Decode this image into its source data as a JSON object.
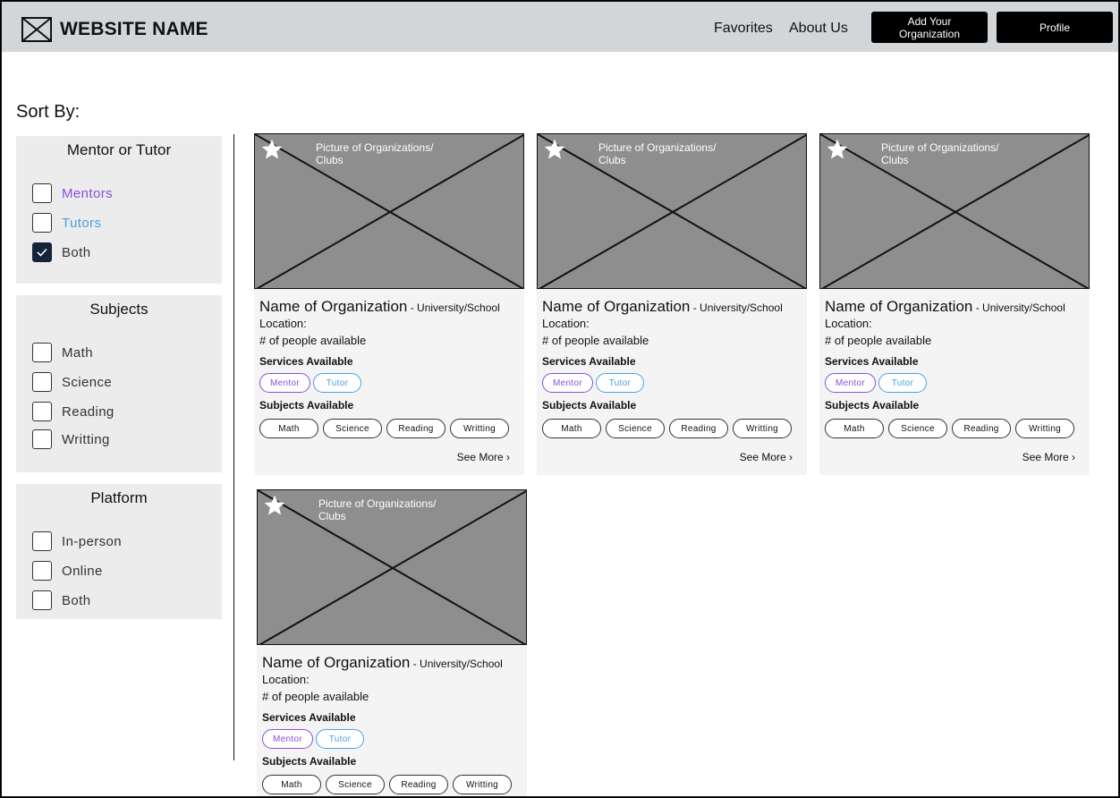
{
  "header": {
    "site_name": "WEBSITE NAME",
    "nav": {
      "favorites": "Favorites",
      "about": "About Us"
    },
    "add_org_button_line1": "Add Your",
    "add_org_button_line2": "Organization",
    "profile_button": "Profile"
  },
  "sort_title": "Sort By:",
  "filters": {
    "role": {
      "title": "Mentor or Tutor",
      "options": [
        {
          "label": "Mentors",
          "checked": false,
          "color": "#8a4fd8"
        },
        {
          "label": "Tutors",
          "checked": false,
          "color": "#4aa3e0"
        },
        {
          "label": "Both",
          "checked": true,
          "color": "#333333"
        }
      ]
    },
    "subjects": {
      "title": "Subjects",
      "options": [
        {
          "label": "Math",
          "checked": false
        },
        {
          "label": "Science",
          "checked": false
        },
        {
          "label": "Reading",
          "checked": false
        },
        {
          "label": "Writting",
          "checked": false
        }
      ]
    },
    "platform": {
      "title": "Platform",
      "options": [
        {
          "label": "In-person",
          "checked": false
        },
        {
          "label": "Online",
          "checked": false
        },
        {
          "label": "Both",
          "checked": false
        }
      ]
    }
  },
  "card": {
    "image_caption_line1": "Picture of Organizations/",
    "image_caption_line2": "Clubs",
    "name": "Name of Organization",
    "type": " - University/School",
    "location": "Location:",
    "people": "# of people available",
    "services_label": "Services Available",
    "services": [
      "Mentor",
      "Tutor"
    ],
    "subjects_label": "Subjects Available",
    "subjects": [
      "Math",
      "Science",
      "Reading",
      "Writting"
    ],
    "see_more": "See More ›"
  },
  "cards_count_label": "4",
  "colors": {
    "mentor": "#8a4fd8",
    "tutor": "#4aa3e0",
    "header_bg": "#d3d6d9",
    "checked": "#13243a"
  }
}
